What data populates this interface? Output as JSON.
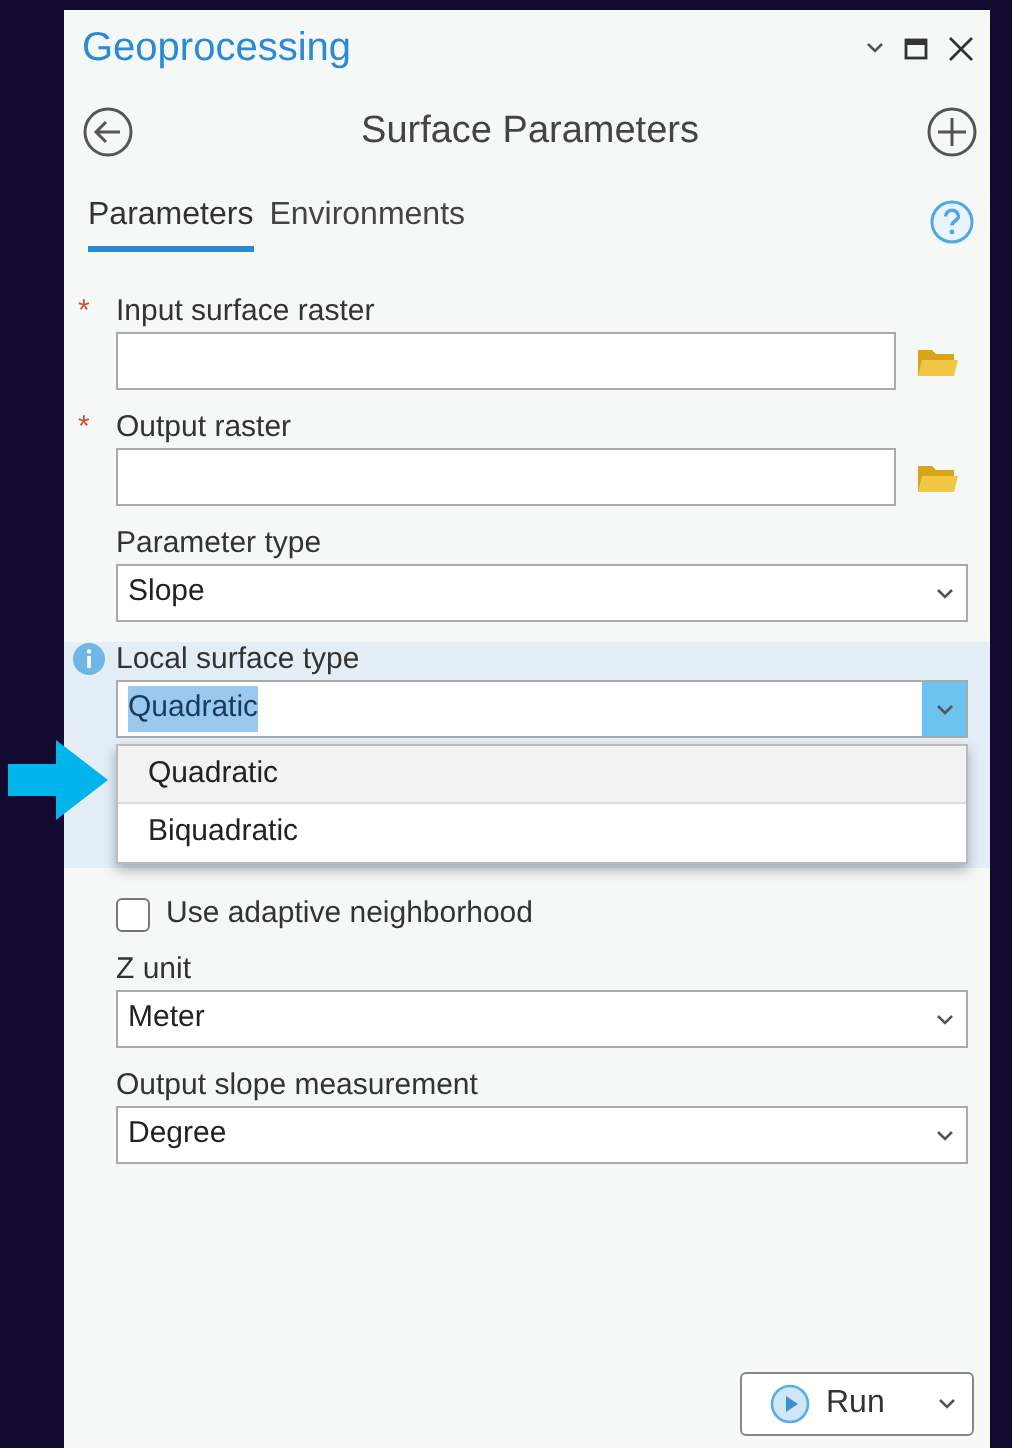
{
  "window": {
    "title": "Geoprocessing"
  },
  "tool": {
    "title": "Surface Parameters"
  },
  "tabs": [
    {
      "label": "Parameters",
      "selected": true
    },
    {
      "label": "Environments",
      "selected": false
    }
  ],
  "parameters": [
    {
      "kind": "path",
      "label": "Input surface raster",
      "required_mark": "*"
    },
    {
      "kind": "path",
      "label": "Output raster",
      "required_mark": "*"
    },
    {
      "kind": "select",
      "label": "Parameter type",
      "value": "Slope"
    },
    {
      "kind": "select",
      "label": "Local surface type",
      "value": "Quadratic",
      "info": true,
      "expanded": true,
      "options": [
        {
          "label": "Quadratic",
          "selected": true
        },
        {
          "label": "Biquadratic",
          "selected": false
        }
      ]
    },
    {
      "kind": "checkbox",
      "label": "Use adaptive neighborhood",
      "checked": false
    },
    {
      "kind": "select",
      "label": "Z unit",
      "value": "Meter"
    },
    {
      "kind": "select",
      "label": "Output slope measurement",
      "value": "Degree"
    }
  ],
  "run_button": {
    "label": "Run"
  }
}
